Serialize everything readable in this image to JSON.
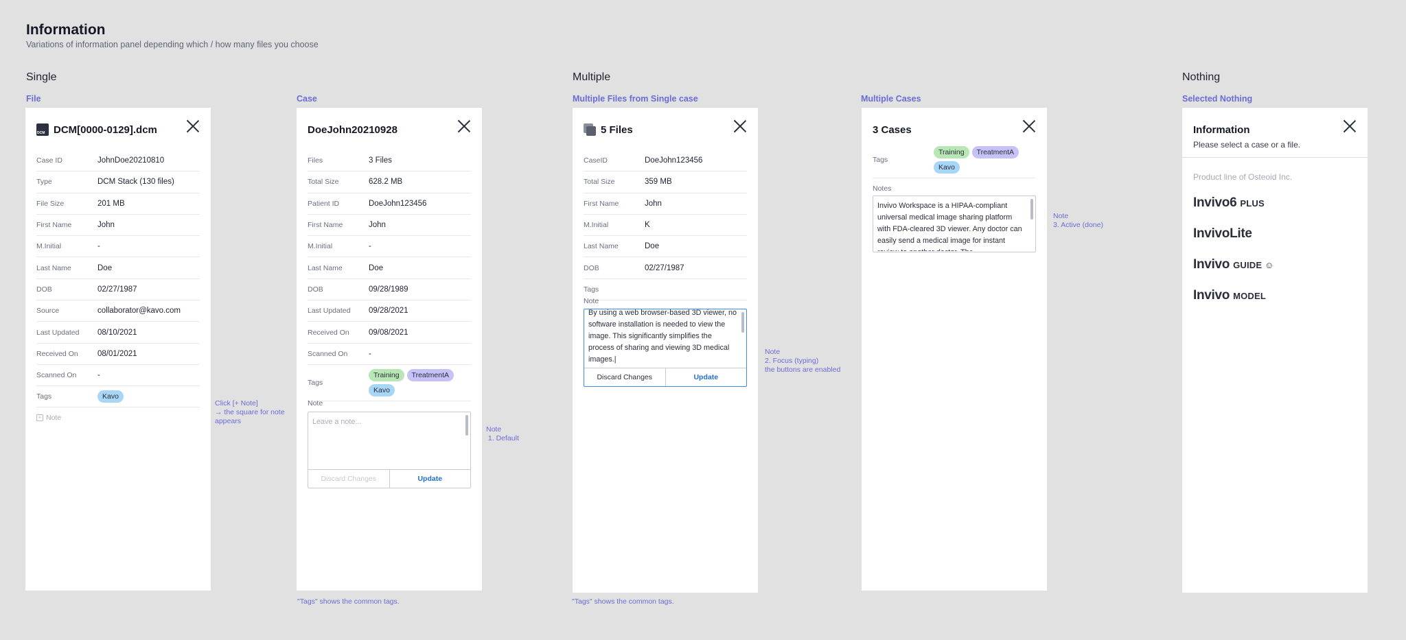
{
  "page": {
    "title": "Information",
    "subtitle": "Variations of information panel depending which / how many files you choose"
  },
  "sections": {
    "single": "Single",
    "multiple": "Multiple",
    "nothing": "Nothing"
  },
  "file_panel": {
    "label": "File",
    "title": "DCM[0000-0129].dcm",
    "rows": [
      {
        "k": "Case ID",
        "v": "JohnDoe20210810"
      },
      {
        "k": "Type",
        "v": "DCM Stack (130 files)"
      },
      {
        "k": "File Size",
        "v": "201 MB"
      },
      {
        "k": "First Name",
        "v": "John"
      },
      {
        "k": "M.Initial",
        "v": "-"
      },
      {
        "k": "Last Name",
        "v": "Doe"
      },
      {
        "k": "DOB",
        "v": "02/27/1987"
      },
      {
        "k": "Source",
        "v": "collaborator@kavo.com"
      },
      {
        "k": "Last Updated",
        "v": "08/10/2021"
      },
      {
        "k": "Received On",
        "v": "08/01/2021"
      },
      {
        "k": "Scanned On",
        "v": "-"
      }
    ],
    "tags_label": "Tags",
    "tags": [
      "Kavo"
    ],
    "add_note": "Note",
    "side_note_1": "Click [+ Note]",
    "side_note_2": "→ the square for note",
    "side_note_3": "appears"
  },
  "case_panel": {
    "label": "Case",
    "title": "DoeJohn20210928",
    "rows": [
      {
        "k": "Files",
        "v": "3 Files"
      },
      {
        "k": "Total Size",
        "v": "628.2 MB"
      },
      {
        "k": "Patient ID",
        "v": "DoeJohn123456"
      },
      {
        "k": "First Name",
        "v": "John"
      },
      {
        "k": "M.Initial",
        "v": "-"
      },
      {
        "k": "Last Name",
        "v": "Doe"
      },
      {
        "k": "DOB",
        "v": "09/28/1989"
      },
      {
        "k": "Last Updated",
        "v": "09/28/2021"
      },
      {
        "k": "Received On",
        "v": "09/08/2021"
      },
      {
        "k": "Scanned On",
        "v": "-"
      }
    ],
    "tags_label": "Tags",
    "tags": [
      "Training",
      "TreatmentA",
      "Kavo"
    ],
    "note_label": "Note",
    "note_placeholder": "Leave a note...",
    "discard": "Discard Changes",
    "update": "Update",
    "side_note_1": "Note",
    "side_note_2": " 1. Default",
    "footnote": "\"Tags\" shows the common tags."
  },
  "multi_files_panel": {
    "label": "Multiple Files from Single case",
    "title": "5 Files",
    "rows": [
      {
        "k": "CaseID",
        "v": "DoeJohn123456"
      },
      {
        "k": "Total Size",
        "v": "359 MB"
      },
      {
        "k": "First Name",
        "v": "John"
      },
      {
        "k": "M.Initial",
        "v": "K"
      },
      {
        "k": "Last Name",
        "v": "Doe"
      },
      {
        "k": "DOB",
        "v": "02/27/1987"
      },
      {
        "k": "Tags",
        "v": ""
      }
    ],
    "note_label": "Note",
    "note_text": "By using a web browser-based 3D viewer, no software installation is needed to view the image. This significantly simplifies the process of sharing and viewing 3D medical images.|",
    "discard": "Discard Changes",
    "update": "Update",
    "side_note_1": "Note",
    "side_note_2": "2. Focus (typing)",
    "side_note_3": "the buttons are enabled",
    "footnote": "\"Tags\" shows the common tags."
  },
  "multi_cases_panel": {
    "label": "Multiple Cases",
    "title": "3 Cases",
    "tags_label": "Tags",
    "tags": [
      "Training",
      "TreatmentA",
      "Kavo"
    ],
    "notes_label": "Notes",
    "note_text": "Invivo Workspace is a HIPAA-compliant universal medical image sharing platform with FDA-cleared 3D viewer. Any doctor can easily send a medical image for instant review to another doctor. The",
    "side_note_1": "Note",
    "side_note_2": "3. Active (done)"
  },
  "nothing_panel": {
    "label": "Selected Nothing",
    "title": "Information",
    "subtitle": "Please select a case or a file.",
    "product_line": "Product line of Osteoid Inc.",
    "logos": [
      {
        "main": "Invivo6",
        "suffix": "PLUS"
      },
      {
        "main": "InvivoLite",
        "suffix": ""
      },
      {
        "main": "Invivo",
        "suffix": "GUIDE ☺"
      },
      {
        "main": "Invivo",
        "suffix": "MODEL"
      }
    ]
  },
  "colors": {
    "background": "#e1e1e2",
    "accent_label": "#6b6bd6",
    "update_blue": "#1f6fd1",
    "tag_green": "#b8e6b4",
    "tag_purple": "#c6c2f7",
    "tag_blue": "#a8d6f7"
  }
}
